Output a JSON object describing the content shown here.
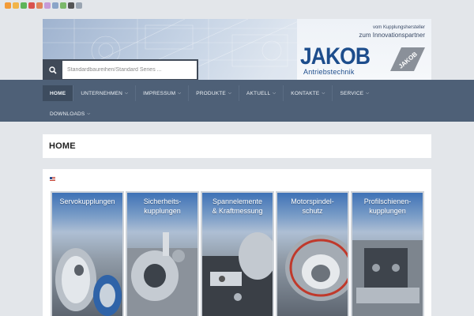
{
  "social": [
    "rss-icon",
    "share-icon",
    "link-icon",
    "google-icon",
    "facebook-icon",
    "twitter-icon",
    "email-icon",
    "print-icon",
    "bookmark-icon",
    "pdf-icon"
  ],
  "header": {
    "tagline_1": "vom Kupplungshersteller",
    "tagline_2": "zum Innovationspartner",
    "logo_word": "JAKOB",
    "logo_sub": "Antriebstechnik",
    "logo_badge": "JAKOB"
  },
  "search": {
    "placeholder": "Standardbaureihen/Standard Series ..."
  },
  "nav": {
    "items": [
      {
        "label": "Home"
      },
      {
        "label": "Unternehmen"
      },
      {
        "label": "Impressum"
      },
      {
        "label": "Produkte"
      },
      {
        "label": "Aktuell"
      },
      {
        "label": "Kontakte"
      },
      {
        "label": "Service"
      },
      {
        "label": "Downloads"
      }
    ]
  },
  "page": {
    "title": "HOME"
  },
  "tiles": [
    {
      "label": "Servokupplungen"
    },
    {
      "label": "Sicherheits-\nkupplungen"
    },
    {
      "label": "Spannelemente\n& Kraftmessung"
    },
    {
      "label": "Motorspindel-\nschutz"
    },
    {
      "label": "Profilschienen-\nkupplungen"
    }
  ],
  "colors": {
    "nav": "#4e6077",
    "brand": "#1d4d8c",
    "search_button": "#404a58"
  }
}
